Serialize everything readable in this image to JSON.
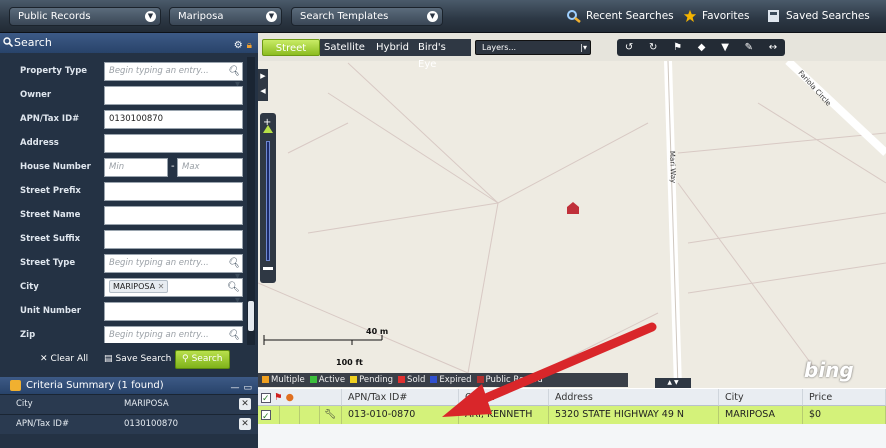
{
  "topbar": {
    "selects": [
      "Public Records",
      "Mariposa",
      "Search Templates"
    ],
    "recent": "Recent Searches",
    "favorites": "Favorites",
    "saved": "Saved Searches"
  },
  "search_panel": {
    "title": "Search",
    "fields": [
      {
        "label": "Property Type",
        "value": "",
        "placeholder": "Begin typing an entry..."
      },
      {
        "label": "Owner",
        "value": "",
        "placeholder": ""
      },
      {
        "label": "APN/Tax ID#",
        "value": "0130100870",
        "placeholder": ""
      },
      {
        "label": "Address",
        "value": "",
        "placeholder": ""
      },
      {
        "label": "House Number",
        "min_placeholder": "Min",
        "max_placeholder": "Max"
      },
      {
        "label": "Street Prefix",
        "value": "",
        "placeholder": ""
      },
      {
        "label": "Street Name",
        "value": "",
        "placeholder": ""
      },
      {
        "label": "Street Suffix",
        "value": "",
        "placeholder": ""
      },
      {
        "label": "Street Type",
        "value": "",
        "placeholder": "Begin typing an entry..."
      },
      {
        "label": "City",
        "value": "MARIPOSA",
        "placeholder": ""
      },
      {
        "label": "Unit Number",
        "value": "",
        "placeholder": ""
      },
      {
        "label": "Zip",
        "value": "",
        "placeholder": "Begin typing an entry..."
      }
    ],
    "clear_all": "Clear All",
    "save_search": "Save Search",
    "search": "Search"
  },
  "criteria_summary": {
    "title": "Criteria Summary",
    "count": "(1 found)",
    "rows": [
      {
        "key": "City",
        "value": "MARIPOSA"
      },
      {
        "key": "APN/Tax ID#",
        "value": "0130100870"
      }
    ]
  },
  "map": {
    "views": [
      "Street",
      "Satellite",
      "Hybrid",
      "Bird's Eye"
    ],
    "active_view": "Street",
    "layers": "Layers...",
    "scale_top": "40 m",
    "scale_bottom": "100 ft",
    "road_labels": [
      "Fariola Circle",
      "Mari Way"
    ],
    "logo": "bing",
    "legend": [
      {
        "label": "Multiple",
        "color": "#f0a020"
      },
      {
        "label": "Active",
        "color": "#3cbf3c"
      },
      {
        "label": "Pending",
        "color": "#f0d020"
      },
      {
        "label": "Sold",
        "color": "#e03030"
      },
      {
        "label": "Expired",
        "color": "#3050d0"
      },
      {
        "label": "Public Record",
        "color": "#b03030"
      }
    ]
  },
  "grid": {
    "columns": [
      "APN/Tax ID#",
      "Owner",
      "Address",
      "City",
      "Price"
    ],
    "rows": [
      {
        "apn": "013-010-0870",
        "owner": "ARI, KENNETH",
        "address": "5320 STATE HIGHWAY 49 N",
        "city": "MARIPOSA",
        "price": "$0"
      }
    ]
  },
  "colors": {
    "accent_green": "#d4f27a",
    "panel": "#243244",
    "arrow": "#d9262a"
  }
}
